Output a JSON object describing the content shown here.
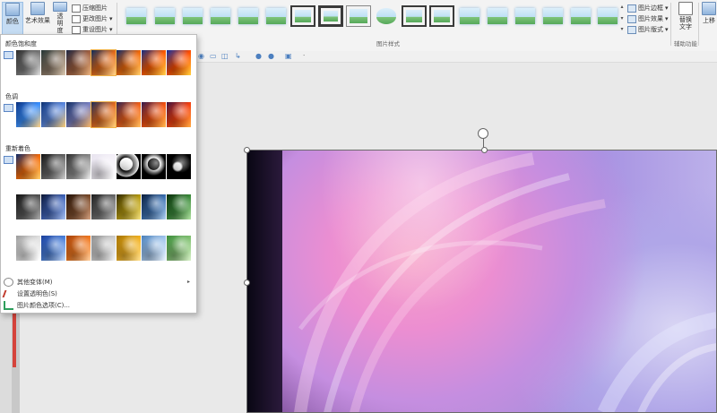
{
  "ribbon": {
    "color_btn": "颜色",
    "art_effect_btn": "艺术效果",
    "transparency_btn": "透明度",
    "compress_label": "压缩图片",
    "change_label": "更改图片",
    "reset_label": "重设图片",
    "group_picture_styles": "图片样式",
    "border_label": "图片边框",
    "effects_label": "图片效果",
    "layout_label": "图片版式",
    "alt_text_btn": "替换文字",
    "group_accessibility": "辅助功能",
    "up_btn": "上移"
  },
  "dropdown": {
    "header_saturation": "颜色饱和度",
    "header_tone": "色调",
    "header_recolor": "重新着色",
    "more_variations": "其他变体(M)",
    "set_transparent": "设置透明色(S)",
    "color_options": "图片颜色选项(C)..."
  },
  "colors": {
    "accent": "#4c7fbf",
    "selection": "#f0b34a",
    "menu_red": "#d5433b"
  }
}
